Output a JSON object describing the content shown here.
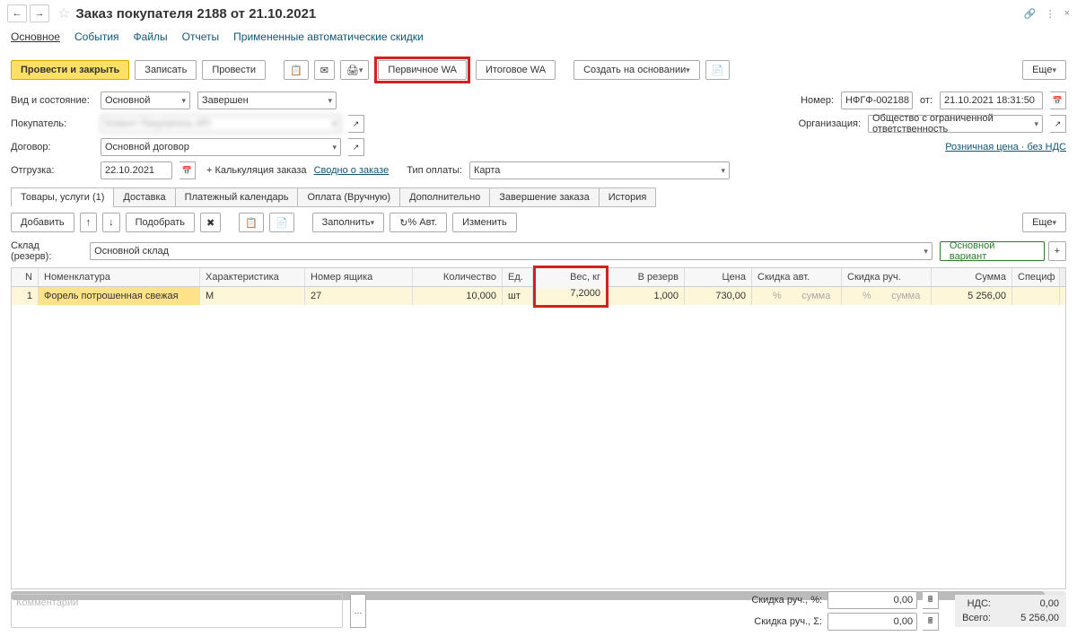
{
  "title": "Заказ покупателя 2188 от 21.10.2021",
  "nav": {
    "main": "Основное",
    "events": "События",
    "files": "Файлы",
    "reports": "Отчеты",
    "discounts": "Примененные автоматические скидки"
  },
  "tb": {
    "postclose": "Провести и закрыть",
    "write": "Записать",
    "post": "Провести",
    "p_wa": "Первичное WA",
    "i_wa": "Итоговое WA",
    "create": "Создать на основании",
    "more": "Еще"
  },
  "form": {
    "kind_lbl": "Вид и состояние:",
    "kind_val": "Основной",
    "status_val": "Завершен",
    "buyer_lbl": "Покупатель:",
    "buyer_val": "Клиент Покупатель ИП",
    "contract_lbl": "Договор:",
    "contract_val": "Основной договор",
    "ship_lbl": "Отгрузка:",
    "ship_val": "22.10.2021",
    "calc": "+ Калькуляция заказа",
    "summary": "Сводно о заказе",
    "paytype_lbl": "Тип оплаты:",
    "paytype_val": "Карта",
    "num_lbl": "Номер:",
    "num_val": "НФГФ-002188",
    "from_lbl": "от:",
    "date_val": "21.10.2021 18:31:50",
    "org_lbl": "Организация:",
    "org_val": "Общество с ограниченной ответственность",
    "price_link": "Розничная цена · без НДС"
  },
  "tabs2": {
    "goods": "Товары, услуги (1)",
    "delivery": "Доставка",
    "paycal": "Платежный календарь",
    "payman": "Оплата (Вручную)",
    "extra": "Дополнительно",
    "finish": "Завершение заказа",
    "history": "История"
  },
  "sub": {
    "add": "Добавить",
    "pick": "Подобрать",
    "fill": "Заполнить",
    "pct": "% Авт.",
    "change": "Изменить",
    "stock_lbl": "Склад (резерв):",
    "stock_val": "Основной склад",
    "main_var": "Основной вариант"
  },
  "th": {
    "n": "N",
    "nom": "Номенклатура",
    "har": "Характеристика",
    "box": "Номер ящика",
    "qty": "Количество",
    "ed": "Ед.",
    "ves": "Вес, кг",
    "rez": "В резерв",
    "price": "Цена",
    "skavt": "Скидка авт.",
    "skruch": "Скидка руч.",
    "sum": "Сумма",
    "spec": "Специф"
  },
  "row": {
    "n": "1",
    "nom": "Форель потрошенная свежая",
    "har": "М",
    "box": "27",
    "qty": "10,000",
    "ed": "шт",
    "ves": "7,2000",
    "rez": "1,000",
    "price": "730,00",
    "pct": "%",
    "amt": "сумма",
    "sum": "5 256,00"
  },
  "footer": {
    "comment_ph": "Комментарий",
    "skpct_lbl": "Скидка руч., %:",
    "sksum_lbl": "Скидка руч., Σ:",
    "zero": "0,00",
    "nds_lbl": "НДС:",
    "nds_val": "0,00",
    "total_lbl": "Всего:",
    "total_val": "5 256,00"
  }
}
